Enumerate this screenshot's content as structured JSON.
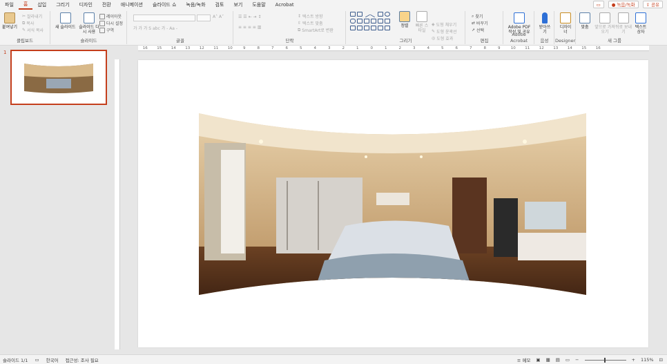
{
  "menu": {
    "tabs": [
      "파일",
      "홈",
      "삽입",
      "그리기",
      "디자인",
      "전환",
      "애니메이션",
      "슬라이드 쇼",
      "녹음/녹화",
      "검토",
      "보기",
      "도움말",
      "Acrobat"
    ],
    "active_index": 1,
    "comment_icon": "comment-icon",
    "record_label": "녹음/녹화",
    "share_label": "공유"
  },
  "ribbon": {
    "clipboard": {
      "label": "클립보드",
      "paste": "붙여넣기",
      "cut": "잘라내기",
      "copy": "복사",
      "format_painter": "서식 복사"
    },
    "slides": {
      "label": "슬라이드",
      "new_slide": "새 슬라이드",
      "reuse_slide": "슬라이드 다시 사용",
      "layout": "레이아웃",
      "reset": "다시 설정",
      "section": "구역"
    },
    "font": {
      "label": "글꼴",
      "font_name": "",
      "font_size": "",
      "buttons": "가 가 가 S abc 가 - Aa -"
    },
    "paragraph": {
      "label": "단락",
      "text_direction": "텍스트 방향",
      "align_text": "텍스트 맞춤",
      "smartart": "SmartArt로 변환"
    },
    "drawing": {
      "label": "그리기",
      "arrange": "정렬",
      "quick_styles": "빠른 스타일",
      "shape_fill": "도형 채우기",
      "shape_outline": "도형 윤곽선",
      "shape_effects": "도형 효과"
    },
    "editing": {
      "label": "편집",
      "find": "찾기",
      "replace": "바꾸기",
      "select": "선택"
    },
    "adobe": {
      "label": "Adobe Acrobat",
      "button": "Adobe PDF 작성 및 공유"
    },
    "voice": {
      "label": "음성",
      "button": "받아쓰기"
    },
    "designer": {
      "label": "Designer",
      "button": "디자이너"
    },
    "newgroup": {
      "label": "새 그룹",
      "b1": "맞춤",
      "b2": "앞으로 가져오기",
      "b3": "뒤로 보내기",
      "b4": "텍스트 상자"
    }
  },
  "thumbnails": {
    "number": "1"
  },
  "ruler_ticks": [
    "16",
    "15",
    "14",
    "13",
    "12",
    "11",
    "10",
    "9",
    "8",
    "7",
    "6",
    "5",
    "4",
    "3",
    "2",
    "1",
    "0",
    "1",
    "2",
    "3",
    "4",
    "5",
    "6",
    "7",
    "8",
    "9",
    "10",
    "11",
    "12",
    "13",
    "14",
    "15",
    "16"
  ],
  "status": {
    "slide_info": "슬라이드 1/1",
    "language": "한국어",
    "accessibility": "접근성: 조사 필요",
    "notes": "메모",
    "zoom": "115%"
  },
  "colors": {
    "accent": "#c43e1c"
  }
}
